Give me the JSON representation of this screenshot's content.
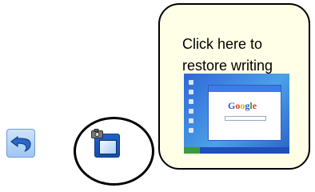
{
  "toolbar": {
    "undo_icon": "undo-arrow-icon",
    "restore_icon": "screenshot-restore-icon"
  },
  "tooltip": {
    "text": "Click here to\nrestore writing"
  },
  "thumbnail": {
    "google_logo_letters": [
      "G",
      "o",
      "o",
      "g",
      "l",
      "e"
    ]
  },
  "colors": {
    "tooltip_bg": "#fffee6",
    "button_blue": "#1f61c9",
    "desktop_blue": "#2f67d8"
  }
}
